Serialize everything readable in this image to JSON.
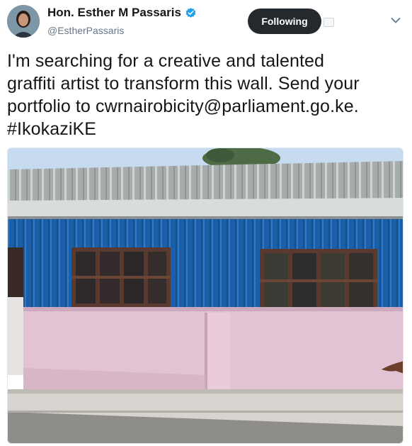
{
  "tweet": {
    "author": {
      "display_name": "Hon. Esther M Passaris",
      "handle": "@EstherPassaris",
      "verified_icon": "verified-badge-icon",
      "avatar_icon": "profile-avatar"
    },
    "follow_button_label": "Following",
    "more_icon": "chevron-down-icon",
    "text": "I'm searching for a creative and talented\ngraffiti artist to transform this wall. Send your\nportfolio to cwrnairobicity@parliament.go.ke.\n#IkokaziKE",
    "media_icon": "photo-building-wall"
  },
  "colors": {
    "follow_bg": "#24292e",
    "verified_blue": "#1da1f2",
    "wall_blue": "#1a5fa8",
    "wall_pink": "#e3c4d3",
    "roof_gray": "#a3a9a9"
  }
}
